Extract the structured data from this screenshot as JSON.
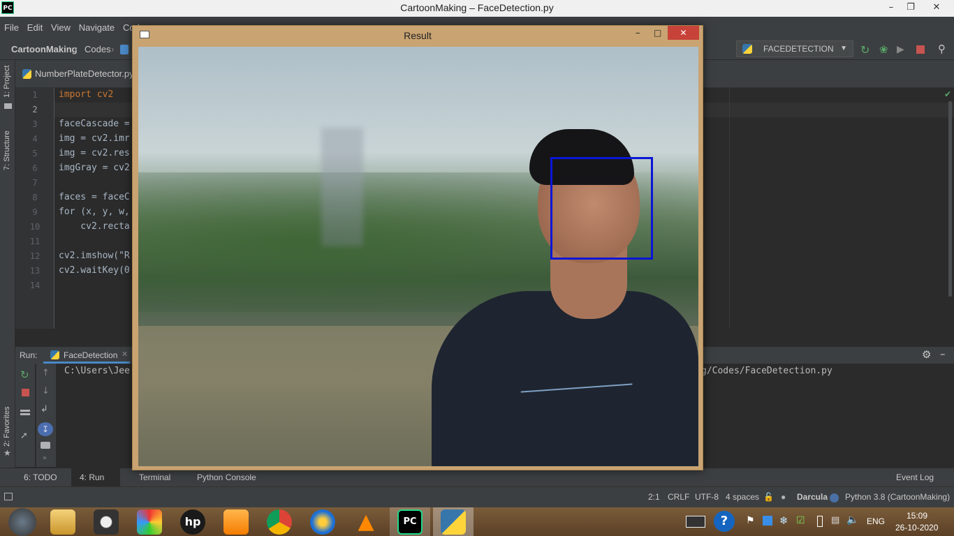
{
  "window": {
    "title": "CartoonMaking – FaceDetection.py",
    "logo": "PC"
  },
  "menu": [
    "File",
    "Edit",
    "View",
    "Navigate",
    "Cod"
  ],
  "breadcrumb": {
    "project": "CartoonMaking",
    "folder": "Codes"
  },
  "run_config": {
    "label": "FACEDETECTION"
  },
  "editor": {
    "tab": "NumberPlateDetector.py",
    "line_numbers": [
      "1",
      "2",
      "3",
      "4",
      "5",
      "6",
      "7",
      "8",
      "9",
      "10",
      "11",
      "12",
      "13",
      "14"
    ],
    "lines": [
      "import cv2",
      "",
      "faceCascade =",
      "img = cv2.imr",
      "img = cv2.res",
      "imgGray = cv2",
      "",
      "faces = faceC",
      "for (x, y, w,",
      "    cv2.recta",
      "",
      "cv2.imshow(\"R",
      "cv2.waitKey(0",
      ""
    ]
  },
  "left_strip": {
    "project": "1: Project",
    "structure": "7: Structure",
    "favorites": "2: Favorites"
  },
  "run_panel": {
    "label": "Run:",
    "tab": "FaceDetection",
    "console_left": "C:\\Users\\Jee",
    "console_right": "g/Codes/FaceDetection.py"
  },
  "result_window": {
    "title": "Result"
  },
  "bottom_tools": {
    "todo": "6: TODO",
    "run": "4: Run",
    "terminal": "Terminal",
    "python_console": "Python Console",
    "event_log": "Event Log"
  },
  "status": {
    "position": "2:1",
    "line_sep": "CRLF",
    "encoding": "UTF-8",
    "indent": "4 spaces",
    "theme": "Darcula",
    "interpreter": "Python 3.8 (CartoonMaking)"
  },
  "taskbar": {
    "lang": "ENG",
    "time": "15:09",
    "date": "26-10-2020"
  },
  "colors": {
    "face_box": "#0a16d6",
    "ide_bg": "#2b2b2b",
    "panel": "#3c3f41",
    "keyword": "#cc7832"
  }
}
